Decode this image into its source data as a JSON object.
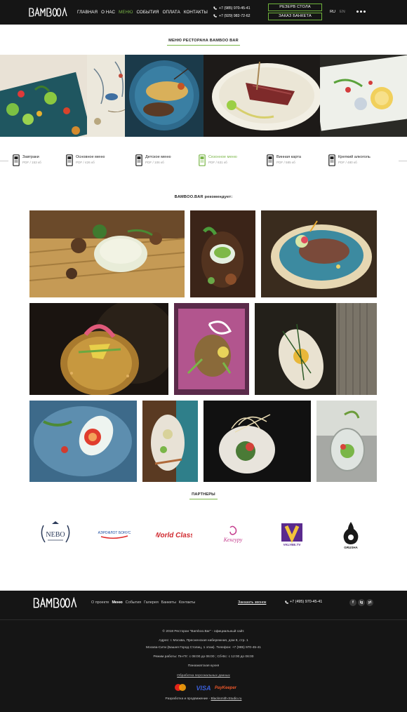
{
  "header": {
    "logo_text": "BAMBOO.BAR",
    "nav": [
      "ГЛАВНАЯ",
      "О НАС",
      "МЕНЮ",
      "СОБЫТИЯ",
      "ОПЛАТА",
      "КОНТАКТЫ"
    ],
    "active_nav": "МЕНЮ",
    "phones": [
      "+7 (985) 970-45-41",
      "+7 (929) 982-72-62"
    ],
    "btn_reserve": "РЕЗЕРВ СТОЛА",
    "btn_banquet": "ЗАКАЗ БАНКЕТА",
    "lang_ru": "RU",
    "lang_en": "EN",
    "more_icon": "more-dots-icon"
  },
  "menu_section": {
    "title": "МЕНЮ РЕСТОРАНА BAMBOO BAR"
  },
  "categories": [
    {
      "title": "Завтраки",
      "sub": "PDF / 153 кб",
      "icon": "document-pdf-icon"
    },
    {
      "title": "Основное меню",
      "sub": "PDF / 426 кб",
      "icon": "document-pdf-icon"
    },
    {
      "title": "Детское меню",
      "sub": "PDF / 106 кб",
      "icon": "document-pdf-icon"
    },
    {
      "title": "Сезонное меню",
      "sub": "PDF / 631 кб",
      "icon": "document-pdf-icon"
    },
    {
      "title": "Винная карта",
      "sub": "PDF / 585 кб",
      "icon": "document-pdf-icon"
    },
    {
      "title": "Крепкий алкоголь",
      "sub": "PDF / 480 кб",
      "icon": "document-pdf-icon"
    }
  ],
  "active_category": "Сезонное меню",
  "recommend": {
    "title": "BAMBOO.BAR рекомендует:"
  },
  "partners": {
    "title": "ПАРТНЕРЫ",
    "logos": [
      "NEBO",
      "АЭРОФЛОТ БОНУС",
      "World Class",
      "Кенгуру",
      "VKLYBE.TV",
      "GRUSHA"
    ]
  },
  "footer": {
    "logo_text": "BAMBOO.BAR",
    "nav": [
      "О проекте",
      "Меню",
      "События",
      "Галерея",
      "Банкеты",
      "Контакты"
    ],
    "active_nav": "Меню",
    "call_link": "Заказать звонок",
    "phone": "+7 (495) 970-45-41",
    "social": [
      "f",
      "ig",
      "yt"
    ],
    "copyright": "© 2018 Ресторан \"Bamboo.Bar\" - официальный сайт.",
    "address_1": "Адрес: г. Москва, Пресненская набережная, дом 8, стр. 1",
    "address_2": "Москва-Сити (Башня Город Столиц, 1 этаж). Телефон: +7 (985) 970-45-41",
    "hours": "Режим работы: Пн-Пт: с 08:00 до 06:00 ; Сб-Вс: с 12:00 до 06:00",
    "cuisine": "Паназиатская кухня",
    "privacy": "Обработка персональных данных",
    "payments": [
      "mastercard",
      "VISA",
      "PayKeeper"
    ],
    "dev_text": "Разработка и продвижение - ",
    "dev_link": "Blacksmith-Studio.ru"
  },
  "colors": {
    "accent": "#7ab648",
    "header_bg": "#151515",
    "footer_bg": "#151515"
  }
}
